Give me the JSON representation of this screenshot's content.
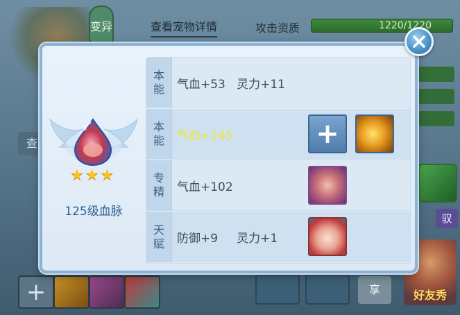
{
  "background": {
    "mutate_button": "变异",
    "tab_label": "查看宠物详情",
    "attack_label": "攻击资质",
    "attack_value": "1220/1220",
    "side_button_label": "查",
    "share_label": "享",
    "friend_label": "好友秀",
    "right_tag_label": "驭"
  },
  "dialog": {
    "close_icon": "close-x-icon",
    "level_label": "125级血脉",
    "stars": 3,
    "rows": [
      {
        "label_line1": "本",
        "label_line2": "能",
        "text": "气血+53   灵力+11",
        "highlight": false
      },
      {
        "label_line1": "本",
        "label_line2": "能",
        "text": "气血+145",
        "highlight": true
      },
      {
        "label_line1": "专",
        "label_line2": "精",
        "text": "气血+102",
        "highlight": false
      },
      {
        "label_line1": "天",
        "label_line2": "赋",
        "text": "防御+9     灵力+1",
        "highlight": false
      }
    ],
    "colors": {
      "highlight_text": "#f2e526",
      "label_text": "#44627c",
      "level_text": "#2e5f92"
    }
  }
}
